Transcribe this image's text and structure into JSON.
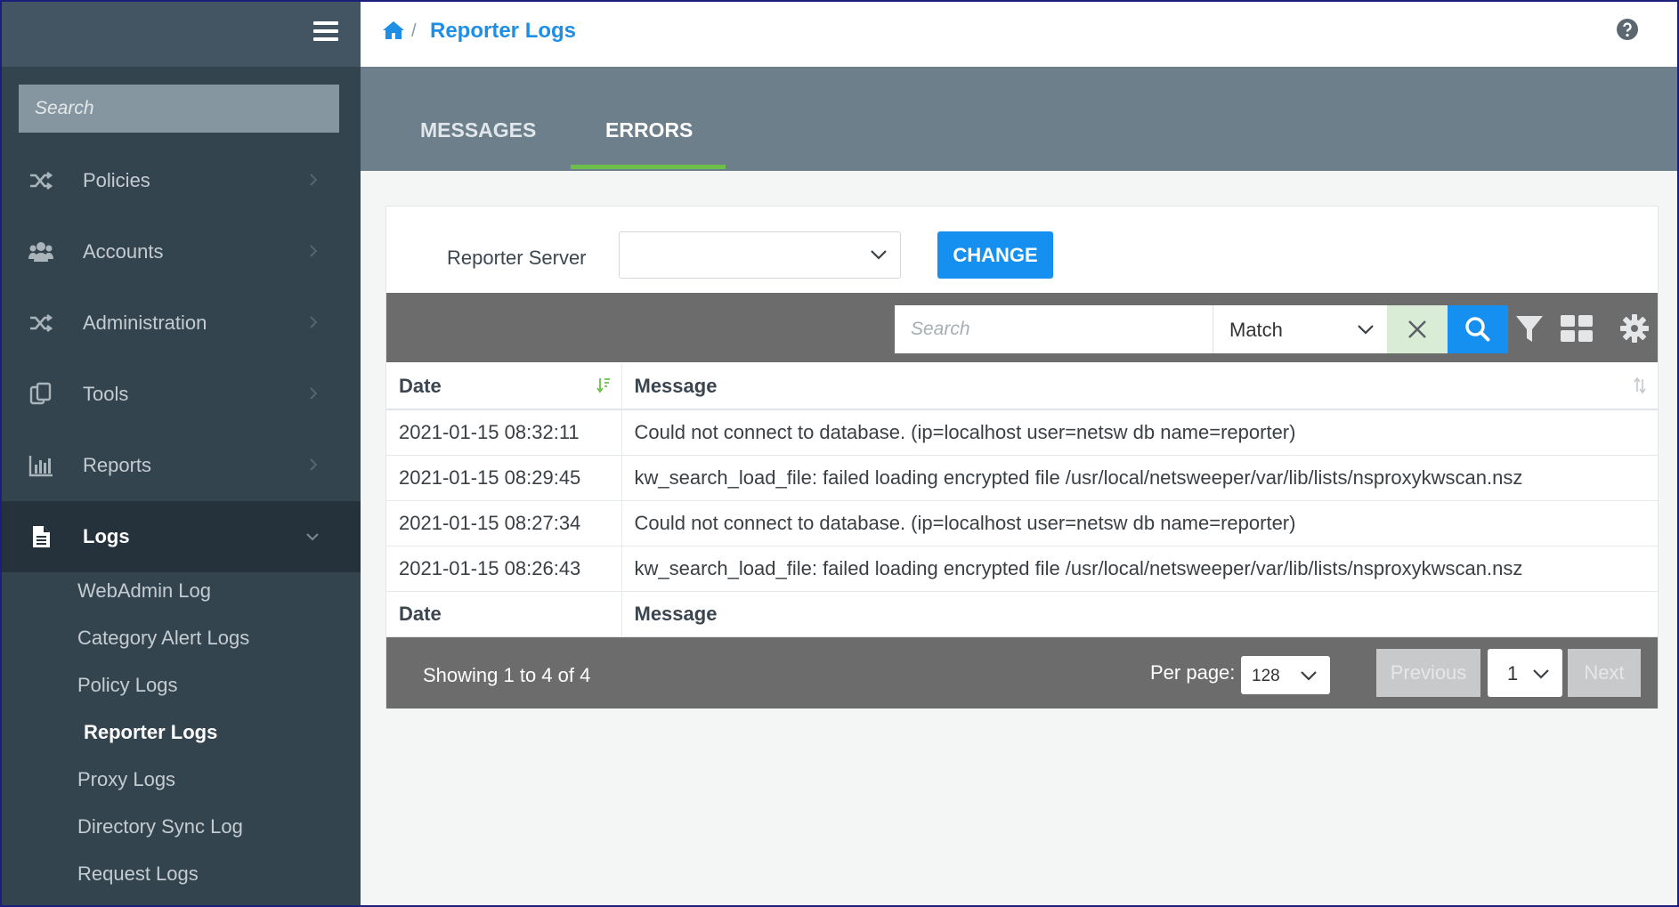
{
  "sidebar": {
    "search_placeholder": "Search",
    "items": [
      {
        "label": "Policies",
        "icon": "shuffle-icon"
      },
      {
        "label": "Accounts",
        "icon": "users-icon"
      },
      {
        "label": "Administration",
        "icon": "shuffle-icon"
      },
      {
        "label": "Tools",
        "icon": "clipboard-icon"
      },
      {
        "label": "Reports",
        "icon": "bar-chart-icon"
      },
      {
        "label": "Logs",
        "icon": "document-icon",
        "active": true
      }
    ],
    "sub_items": [
      {
        "label": "WebAdmin Log"
      },
      {
        "label": "Category Alert Logs"
      },
      {
        "label": "Policy Logs"
      },
      {
        "label": "Reporter Logs",
        "active": true
      },
      {
        "label": "Proxy Logs"
      },
      {
        "label": "Directory Sync Log"
      },
      {
        "label": "Request Logs"
      }
    ]
  },
  "breadcrumb": {
    "separator": "/",
    "current": "Reporter Logs"
  },
  "tabs": [
    {
      "label": "MESSAGES"
    },
    {
      "label": "ERRORS",
      "active": true
    }
  ],
  "reporter_server": {
    "label": "Reporter Server",
    "value": "",
    "button": "CHANGE"
  },
  "toolbar": {
    "search_placeholder": "Search",
    "match_value": "Match"
  },
  "table": {
    "columns": [
      "Date",
      "Message"
    ],
    "rows": [
      {
        "date": "2021-01-15 08:32:11",
        "message": "Could not connect to database. (ip=localhost user=netsw db name=reporter)"
      },
      {
        "date": "2021-01-15 08:29:45",
        "message": "kw_search_load_file: failed loading encrypted file /usr/local/netsweeper/var/lib/lists/nsproxykwscan.nsz"
      },
      {
        "date": "2021-01-15 08:27:34",
        "message": "Could not connect to database. (ip=localhost user=netsw db name=reporter)"
      },
      {
        "date": "2021-01-15 08:26:43",
        "message": "kw_search_load_file: failed loading encrypted file /usr/local/netsweeper/var/lib/lists/nsproxykwscan.nsz"
      }
    ],
    "footer_columns": [
      "Date",
      "Message"
    ]
  },
  "pagination": {
    "showing": "Showing 1 to 4 of 4",
    "per_page_label": "Per page:",
    "per_page_value": "128",
    "previous": "Previous",
    "page": "1",
    "next": "Next"
  },
  "colors": {
    "sidebar_bg": "#34444f",
    "accent_blue": "#1590f0",
    "tab_underline": "#6cc04a",
    "toolbar_bg": "#6c6c6c"
  }
}
